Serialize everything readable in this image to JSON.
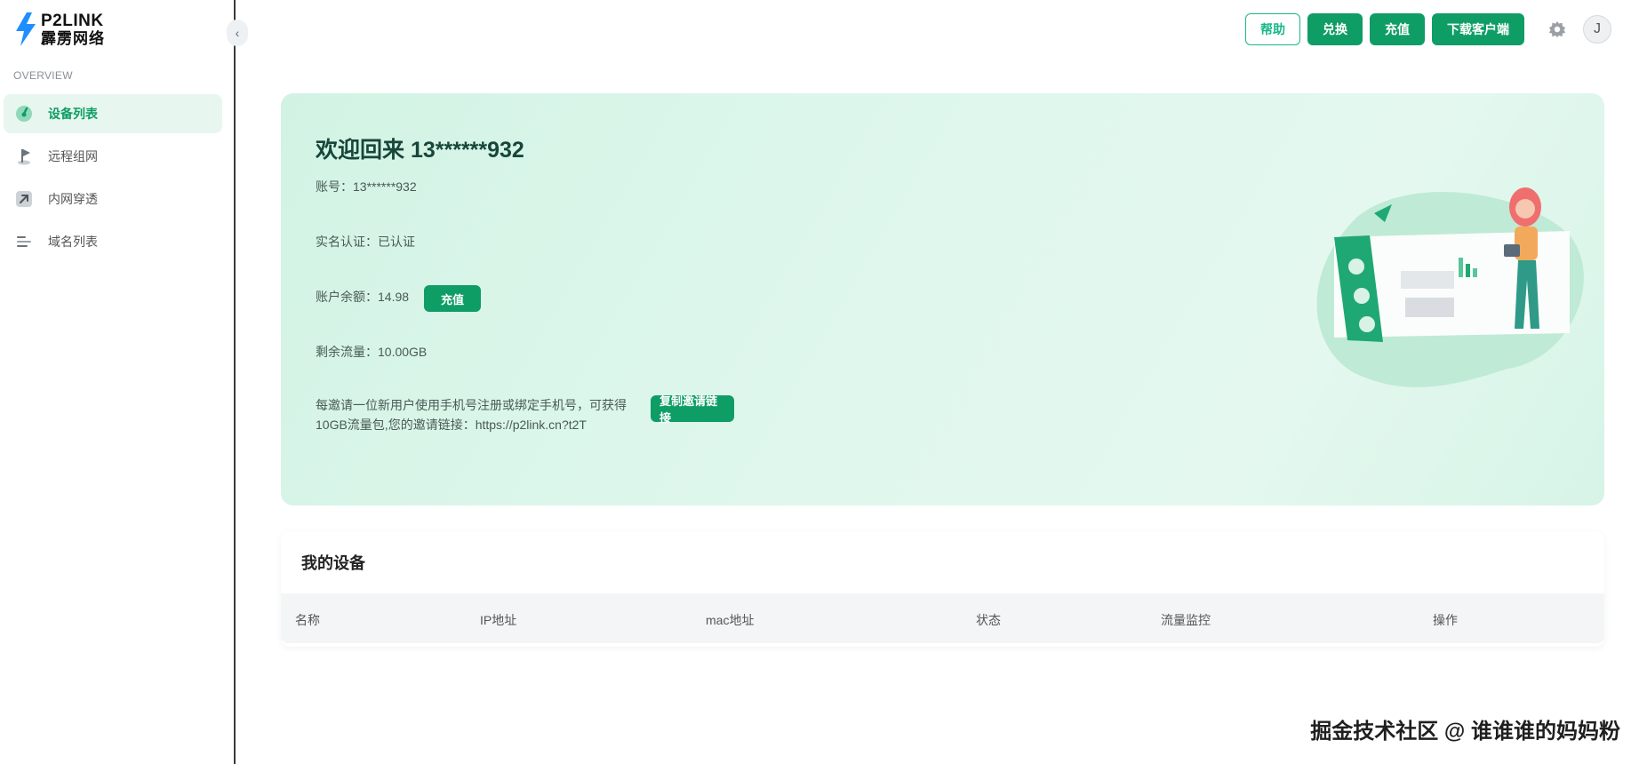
{
  "brand": {
    "line1": "P2LINK",
    "line2": "霹雳网络",
    "color": "#1f8fff"
  },
  "sidebar": {
    "section_label": "OVERVIEW",
    "items": [
      {
        "label": "设备列表",
        "icon": "gauge-icon",
        "active": true
      },
      {
        "label": "远程组网",
        "icon": "flag-icon",
        "active": false
      },
      {
        "label": "内网穿透",
        "icon": "arrow-up-right-icon",
        "active": false
      },
      {
        "label": "域名列表",
        "icon": "list-icon",
        "active": false
      }
    ]
  },
  "header": {
    "help": "帮助",
    "exchange": "兑换",
    "recharge": "充值",
    "download": "下载客户端",
    "avatar_initial": "J"
  },
  "welcome": {
    "title": "欢迎回来 13******932",
    "account": "账号：13******932",
    "realname": "实名认证：已认证",
    "balance": "账户余额：14.98",
    "recharge_btn": "充值",
    "traffic": "剩余流量：10.00GB",
    "invite": "每邀请一位新用户使用手机号注册或绑定手机号，可获得10GB流量包,您的邀请链接：https://p2link.cn?t2T",
    "copy_btn": "复制邀请链接"
  },
  "devices": {
    "title": "我的设备",
    "columns": [
      "名称",
      "IP地址",
      "mac地址",
      "状态",
      "流量监控",
      "操作"
    ]
  },
  "watermark": "掘金技术社区 @ 谁谁谁的妈妈粉",
  "colors": {
    "primary": "#0f9d66",
    "accent": "#19b78a",
    "card_bg": "#d9f5e8"
  }
}
